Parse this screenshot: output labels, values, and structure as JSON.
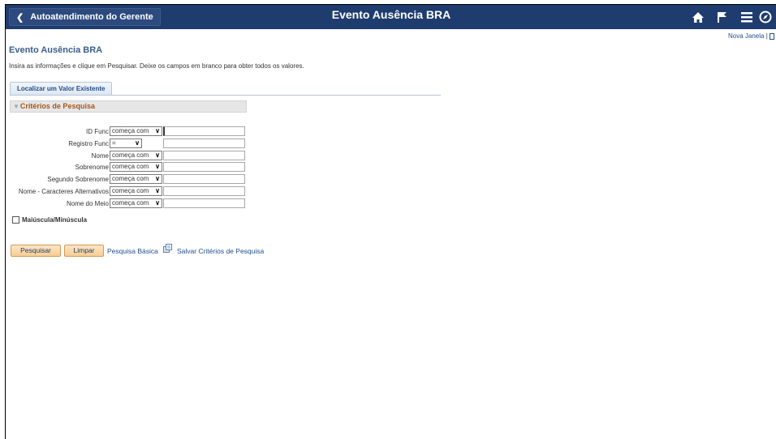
{
  "banner": {
    "back_label": "Autoatendimento do Gerente",
    "title": "Evento Ausência BRA",
    "icons": [
      "home-icon",
      "flag-icon",
      "menu-icon",
      "navbar-compass-icon"
    ]
  },
  "toplinks": {
    "new_window": "Nova Janela",
    "separator": "|"
  },
  "page": {
    "title": "Evento Ausência BRA",
    "instructions": "Insira as informações e clique em Pesquisar. Deixe os campos em branco para obter todos os valores."
  },
  "tab": {
    "label": "Localizar um Valor Existente"
  },
  "section": {
    "title": "Critérios de Pesquisa"
  },
  "fields": [
    {
      "label": "ID Func",
      "operator": "começa com",
      "value": ""
    },
    {
      "label": "Registro Func",
      "operator": "=",
      "value": ""
    },
    {
      "label": "Nome",
      "operator": "começa com",
      "value": ""
    },
    {
      "label": "Sobrenome",
      "operator": "começa com",
      "value": ""
    },
    {
      "label": "Segundo Sobrenome",
      "operator": "começa com",
      "value": ""
    },
    {
      "label": "Nome - Caracteres Alternativos",
      "operator": "começa com",
      "value": ""
    },
    {
      "label": "Nome do Meio",
      "operator": "começa com",
      "value": ""
    }
  ],
  "case_sensitive": {
    "label": "Maiúscula/Minúscula",
    "checked": false
  },
  "actions": {
    "search": "Pesquisar",
    "clear": "Limpar",
    "basic_search": "Pesquisa Básica",
    "save_criteria": "Salvar Critérios de Pesquisa"
  },
  "colors": {
    "banner": "#1f3c6f",
    "link": "#1f4e8c",
    "section_title": "#a5571a",
    "button": "#f6cd93"
  }
}
